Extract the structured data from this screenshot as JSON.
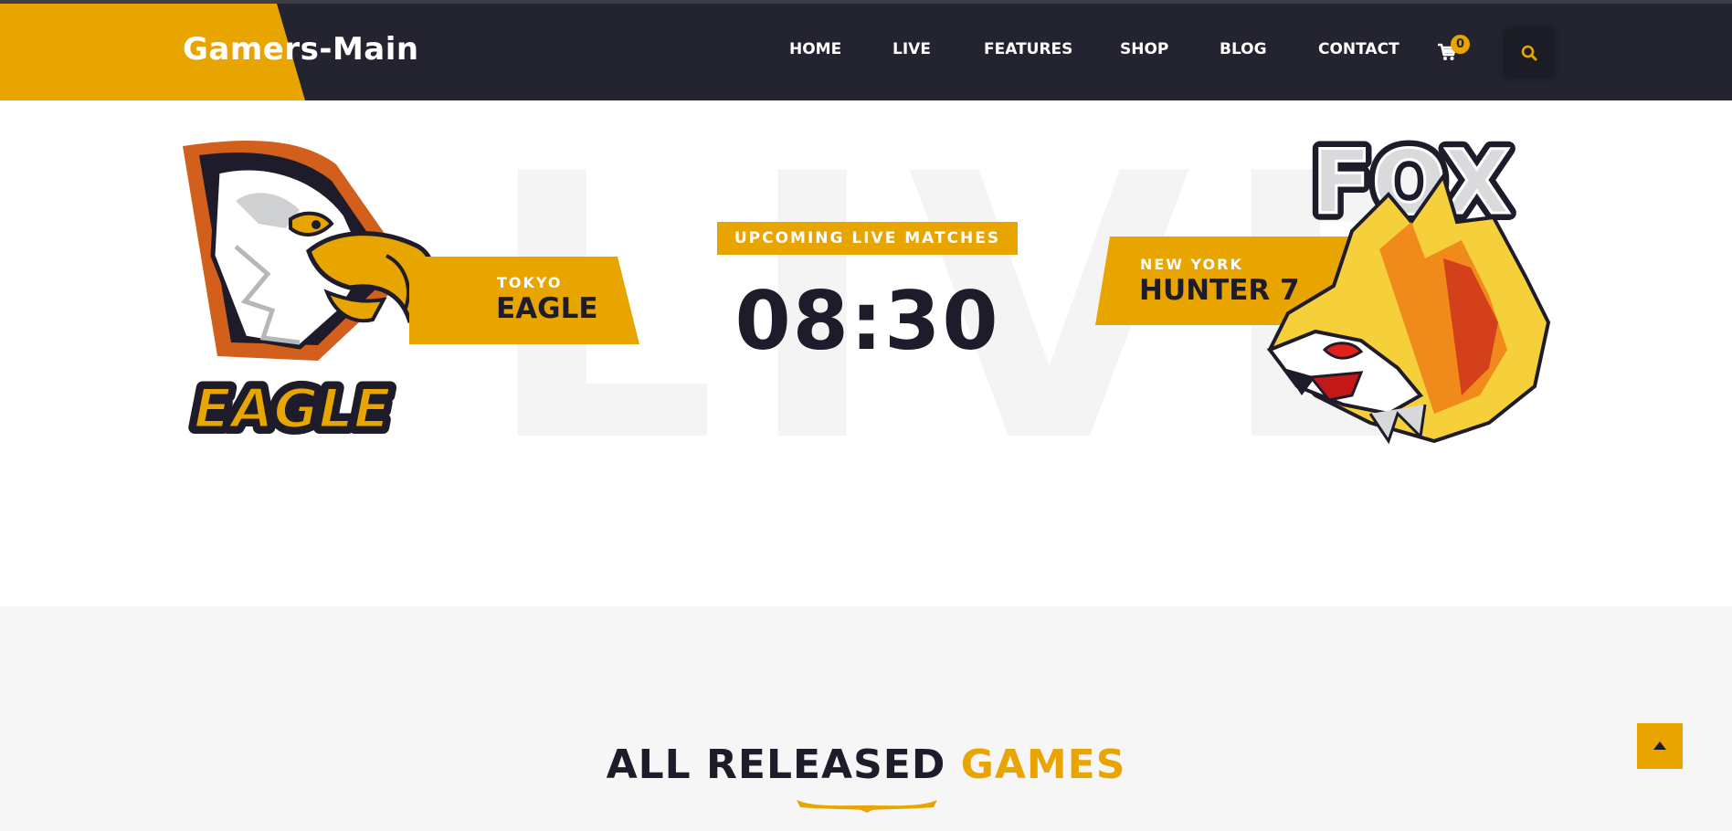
{
  "brand": {
    "name": "Gamers-Main",
    "accent": "#e8a500",
    "dark": "#23242f"
  },
  "nav": {
    "items": [
      {
        "label": "HOME"
      },
      {
        "label": "LIVE"
      },
      {
        "label": "FEATURES"
      },
      {
        "label": "SHOP"
      },
      {
        "label": "BLOG"
      },
      {
        "label": "CONTACT"
      }
    ],
    "cart_count": "0",
    "cart_icon": "cart-icon",
    "search_icon": "search-icon"
  },
  "match": {
    "background_text": "LIVE",
    "upcoming_label": "UPCOMING LIVE MATCHES",
    "time": "08:30",
    "team_left": {
      "city": "TOKYO",
      "name": "EAGLE",
      "logo_text": "EAGLE"
    },
    "team_right": {
      "city": "NEW YORK",
      "name": "HUNTER 7",
      "logo_text": "FOX"
    }
  },
  "games": {
    "title_main": "ALL RELEASED",
    "title_accent": "GAMES"
  },
  "scroll_top_icon": "arrow-up-icon"
}
